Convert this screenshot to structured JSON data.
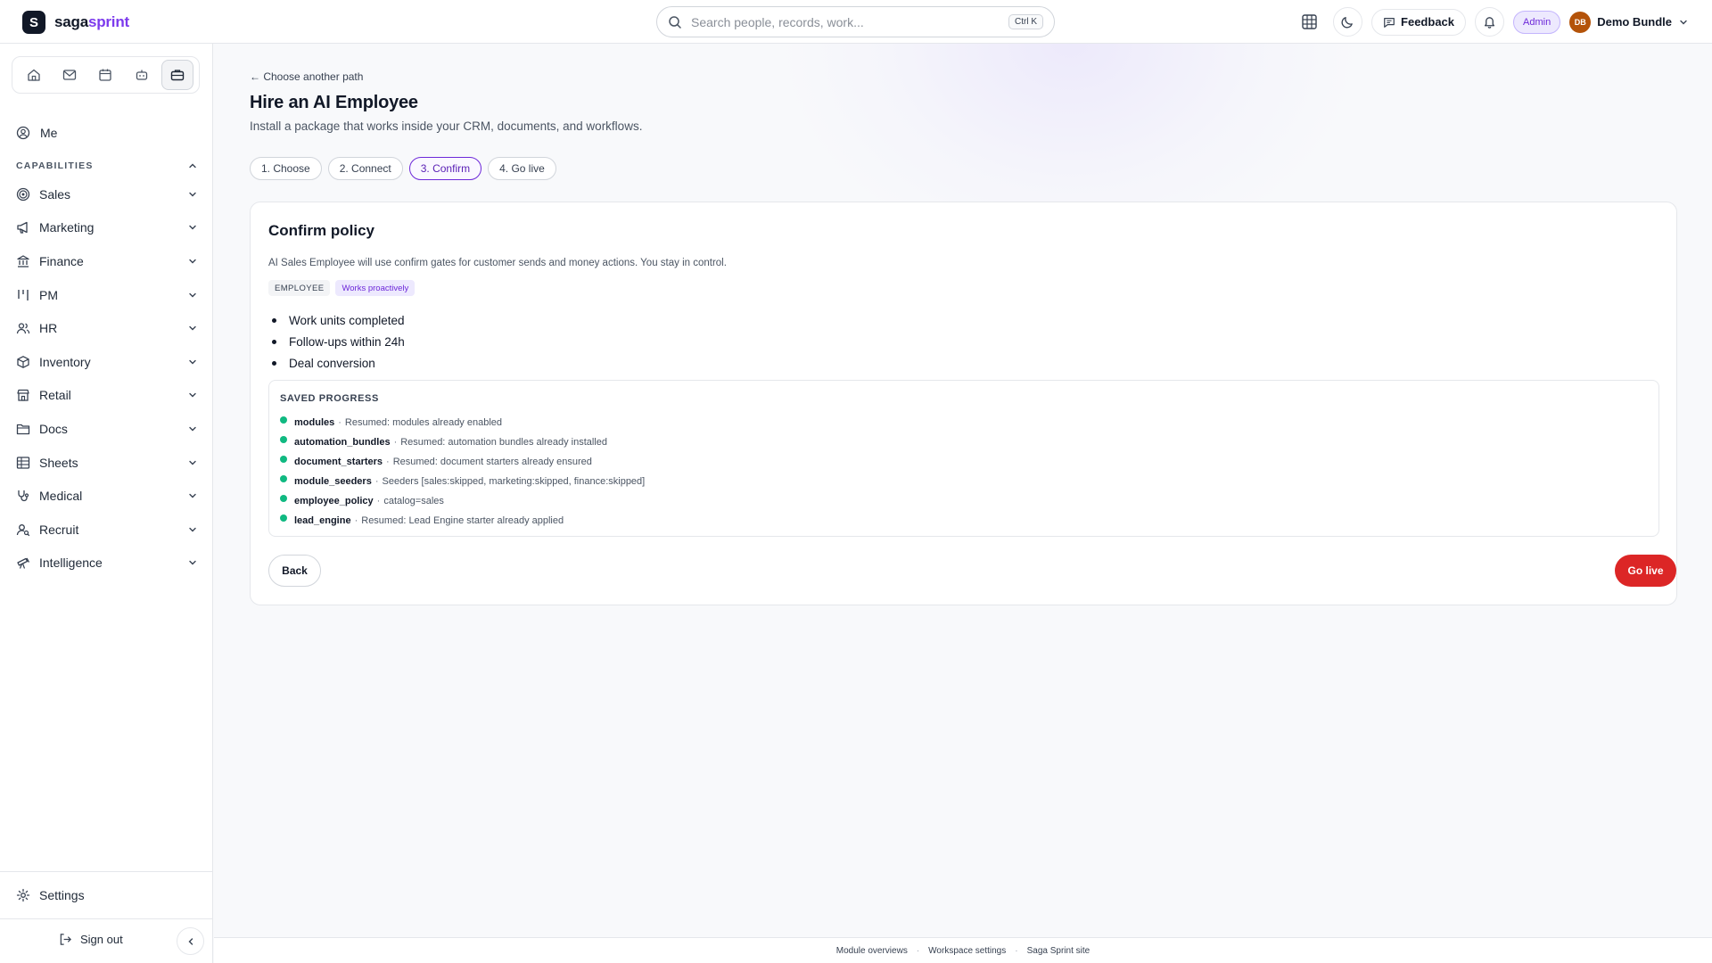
{
  "brand": {
    "mark": "S",
    "name_a": "saga",
    "name_b": "sprint"
  },
  "search": {
    "placeholder": "Search people, records, work...",
    "shortcut": "Ctrl K"
  },
  "topbar": {
    "feedback_label": "Feedback",
    "admin_label": "Admin",
    "user_initials": "DB",
    "user_name": "Demo Bundle"
  },
  "sidebar": {
    "quick_icons": [
      "home-icon",
      "mail-icon",
      "calendar-icon",
      "bot-icon",
      "briefcase-icon"
    ],
    "me_label": "Me",
    "capabilities_label": "CAPABILITIES",
    "items": [
      {
        "label": "Sales",
        "icon": "target-icon"
      },
      {
        "label": "Marketing",
        "icon": "megaphone-icon"
      },
      {
        "label": "Finance",
        "icon": "bank-icon"
      },
      {
        "label": "PM",
        "icon": "kanban-icon"
      },
      {
        "label": "HR",
        "icon": "people-icon"
      },
      {
        "label": "Inventory",
        "icon": "box-icon"
      },
      {
        "label": "Retail",
        "icon": "store-icon"
      },
      {
        "label": "Docs",
        "icon": "folder-icon"
      },
      {
        "label": "Sheets",
        "icon": "table-icon"
      },
      {
        "label": "Medical",
        "icon": "stethoscope-icon"
      },
      {
        "label": "Recruit",
        "icon": "user-search-icon"
      },
      {
        "label": "Intelligence",
        "icon": "telescope-icon"
      }
    ],
    "settings_label": "Settings",
    "signout_label": "Sign out"
  },
  "main": {
    "back_link": "← Choose another path",
    "title": "Hire an AI Employee",
    "subtitle": "Install a package that works inside your CRM, documents, and workflows.",
    "steps": [
      {
        "label": "1. Choose",
        "active": false
      },
      {
        "label": "2. Connect",
        "active": false
      },
      {
        "label": "3. Confirm",
        "active": true
      },
      {
        "label": "4. Go live",
        "active": false
      }
    ],
    "card": {
      "title": "Confirm policy",
      "description": "AI Sales Employee will use confirm gates for customer sends and money actions. You stay in control.",
      "chips": [
        "EMPLOYEE",
        "Works proactively"
      ],
      "bullets": [
        "Work units completed",
        "Follow-ups within 24h",
        "Deal conversion"
      ],
      "progress_title": "SAVED PROGRESS",
      "progress": [
        {
          "key": "modules",
          "value": "Resumed: modules already enabled"
        },
        {
          "key": "automation_bundles",
          "value": "Resumed: automation bundles already installed"
        },
        {
          "key": "document_starters",
          "value": "Resumed: document starters already ensured"
        },
        {
          "key": "module_seeders",
          "value": "Seeders [sales:skipped, marketing:skipped, finance:skipped]"
        },
        {
          "key": "employee_policy",
          "value": "catalog=sales"
        },
        {
          "key": "lead_engine",
          "value": "Resumed: Lead Engine starter already applied"
        }
      ],
      "back_label": "Back",
      "golive_label": "Go live"
    }
  },
  "footer": {
    "links": [
      "Module overviews",
      "Workspace settings",
      "Saga Sprint site"
    ]
  },
  "colors": {
    "accent": "#6d28d9",
    "danger": "#dc2626",
    "success": "#10b981"
  }
}
